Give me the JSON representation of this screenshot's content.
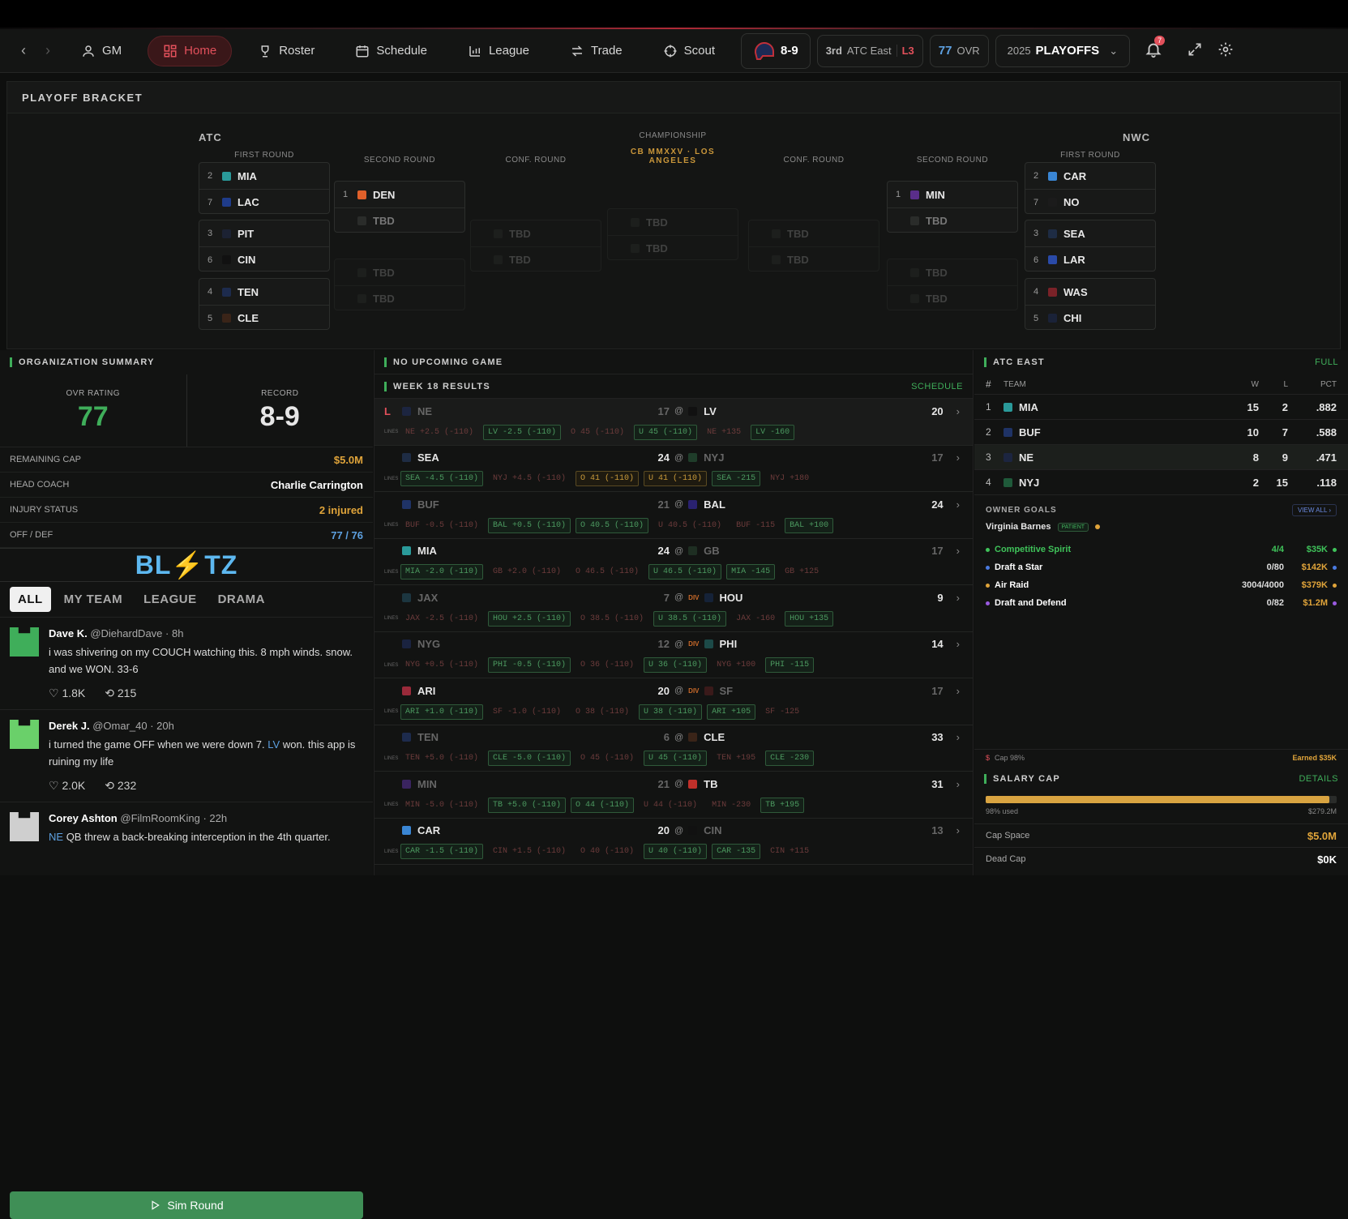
{
  "nav": {
    "user": "GM",
    "items": [
      "Home",
      "Roster",
      "Schedule",
      "League",
      "Trade",
      "Scout"
    ],
    "record": "8-9",
    "standing_rank": "3rd",
    "standing_div": "ATC East",
    "streak": "L3",
    "ovr": "77",
    "ovr_label": "OVR",
    "season": "2025",
    "phase": "PLAYOFFS",
    "notif": "7"
  },
  "bracket": {
    "title": "PLAYOFF BRACKET",
    "left_conf": "ATC",
    "right_conf": "NWC",
    "first_round": "FIRST ROUND",
    "second_round": "SECOND ROUND",
    "conf_round": "CONF. ROUND",
    "championship": "CHAMPIONSHIP",
    "champ_name": "CB MMXXV · LOS ANGELES",
    "tbd": "TBD",
    "left": [
      [
        {
          "seed": "2",
          "team": "MIA",
          "color": "#2a9a9a"
        },
        {
          "seed": "7",
          "team": "LAC",
          "color": "#1f3c8a"
        }
      ],
      [
        {
          "seed": "3",
          "team": "PIT",
          "color": "#1c2233"
        },
        {
          "seed": "6",
          "team": "CIN",
          "color": "#111"
        }
      ],
      [
        {
          "seed": "4",
          "team": "TEN",
          "color": "#1d2b4d"
        },
        {
          "seed": "5",
          "team": "CLE",
          "color": "#3a2418"
        }
      ]
    ],
    "left_second": {
      "seed": "1",
      "team": "DEN",
      "color": "#e0602a"
    },
    "right": [
      [
        {
          "seed": "2",
          "team": "CAR",
          "color": "#3a86d4"
        },
        {
          "seed": "7",
          "team": "NO",
          "color": "#1b1b1b"
        }
      ],
      [
        {
          "seed": "3",
          "team": "SEA",
          "color": "#1e2c44"
        },
        {
          "seed": "6",
          "team": "LAR",
          "color": "#2a4aa8"
        }
      ],
      [
        {
          "seed": "4",
          "team": "WAS",
          "color": "#7a2228"
        },
        {
          "seed": "5",
          "team": "CHI",
          "color": "#1a2238"
        }
      ]
    ],
    "right_second": {
      "seed": "1",
      "team": "MIN",
      "color": "#5a2e8a"
    }
  },
  "org": {
    "title": "ORGANIZATION SUMMARY",
    "ovr_label": "OVR RATING",
    "ovr": "77",
    "record_label": "RECORD",
    "record": "8-9",
    "rows": [
      {
        "k": "REMAINING CAP",
        "v": "$5.0M",
        "c": "#e0a43a"
      },
      {
        "k": "HEAD COACH",
        "v": "Charlie Carrington",
        "c": "#fff"
      },
      {
        "k": "INJURY STATUS",
        "v": "2 injured",
        "c": "#e0a43a"
      },
      {
        "k": "OFF / DEF",
        "v": "77 / 76",
        "c": "#5da0e0"
      }
    ]
  },
  "blitz": {
    "logo": "BL⚡TZ",
    "tabs": [
      "ALL",
      "MY TEAM",
      "LEAGUE",
      "DRAMA"
    ],
    "posts": [
      {
        "name": "Dave K.",
        "handle": "@DiehardDave",
        "time": "8h",
        "text": "i was shivering on my COUCH watching this. 8 mph winds. snow. and we WON. 33-6",
        "likes": "1.8K",
        "rts": "215"
      },
      {
        "name": "Derek J.",
        "handle": "@Omar_40",
        "time": "20h",
        "text_a": "i turned the game OFF when we were down 7.",
        "tag": "LV",
        "text_b": "won. this app is ruining my life",
        "likes": "2.0K",
        "rts": "232"
      },
      {
        "name": "Corey Ashton",
        "handle": "@FilmRoomKing",
        "time": "22h",
        "tag": "NE",
        "text_b": "QB threw a back-breaking interception in the 4th quarter."
      }
    ],
    "sim": "Sim Round"
  },
  "games": {
    "title": "NO UPCOMING GAME",
    "subtitle": "WEEK 18 RESULTS",
    "schedule": "SCHEDULE",
    "lines_label": "LINES",
    "list": [
      {
        "res": "L",
        "a": "NE",
        "ac": "#1c2540",
        "as": "17",
        "h": "LV",
        "hc": "#111",
        "hs": "20",
        "div": false,
        "aw": false,
        "lines": [
          [
            "NE +2.5 (-110)",
            "r"
          ],
          [
            "LV -2.5 (-110)",
            "g"
          ],
          [
            "O 45 (-110)",
            "r"
          ],
          [
            "U 45 (-110)",
            "g"
          ],
          [
            "NE +135",
            "r"
          ],
          [
            "LV -160",
            "g"
          ]
        ]
      },
      {
        "res": "",
        "a": "SEA",
        "ac": "#1e2c44",
        "as": "24",
        "h": "NYJ",
        "hc": "#1f3d2a",
        "hs": "17",
        "div": false,
        "aw": true,
        "lines": [
          [
            "SEA -4.5 (-110)",
            "g"
          ],
          [
            "NYJ +4.5 (-110)",
            "r"
          ],
          [
            "O 41 (-110)",
            "o"
          ],
          [
            "U 41 (-110)",
            "o"
          ],
          [
            "SEA -215",
            "g"
          ],
          [
            "NYJ +180",
            "r"
          ]
        ]
      },
      {
        "res": "",
        "a": "BUF",
        "ac": "#1f3366",
        "as": "21",
        "h": "BAL",
        "hc": "#2a2270",
        "hs": "24",
        "div": false,
        "aw": false,
        "lines": [
          [
            "BUF -0.5 (-110)",
            "r"
          ],
          [
            "BAL +0.5 (-110)",
            "g"
          ],
          [
            "O 40.5 (-110)",
            "g"
          ],
          [
            "U 40.5 (-110)",
            "r"
          ],
          [
            "BUF -115",
            "r"
          ],
          [
            "BAL +100",
            "g"
          ]
        ]
      },
      {
        "res": "",
        "a": "MIA",
        "ac": "#2a9a9a",
        "as": "24",
        "h": "GB",
        "hc": "#1e2e22",
        "hs": "17",
        "div": false,
        "aw": true,
        "lines": [
          [
            "MIA -2.0 (-110)",
            "g"
          ],
          [
            "GB +2.0 (-110)",
            "r"
          ],
          [
            "O 46.5 (-110)",
            "r"
          ],
          [
            "U 46.5 (-110)",
            "g"
          ],
          [
            "MIA -145",
            "g"
          ],
          [
            "GB +125",
            "r"
          ]
        ]
      },
      {
        "res": "",
        "a": "JAX",
        "ac": "#1c3640",
        "as": "7",
        "h": "HOU",
        "hc": "#152238",
        "hs": "9",
        "div": true,
        "aw": false,
        "lines": [
          [
            "JAX -2.5 (-110)",
            "r"
          ],
          [
            "HOU +2.5 (-110)",
            "g"
          ],
          [
            "O 38.5 (-110)",
            "r"
          ],
          [
            "U 38.5 (-110)",
            "g"
          ],
          [
            "JAX -160",
            "r"
          ],
          [
            "HOU +135",
            "g"
          ]
        ]
      },
      {
        "res": "",
        "a": "NYG",
        "ac": "#1a2340",
        "as": "12",
        "h": "PHI",
        "hc": "#1c4a48",
        "hs": "14",
        "div": true,
        "aw": false,
        "lines": [
          [
            "NYG +0.5 (-110)",
            "r"
          ],
          [
            "PHI -0.5 (-110)",
            "g"
          ],
          [
            "O 36 (-110)",
            "r"
          ],
          [
            "U 36 (-110)",
            "g"
          ],
          [
            "NYG +100",
            "r"
          ],
          [
            "PHI -115",
            "g"
          ]
        ]
      },
      {
        "res": "",
        "a": "ARI",
        "ac": "#9a2a3a",
        "as": "20",
        "h": "SF",
        "hc": "#3a1a1a",
        "hs": "17",
        "div": true,
        "aw": true,
        "lines": [
          [
            "ARI +1.0 (-110)",
            "g"
          ],
          [
            "SF -1.0 (-110)",
            "r"
          ],
          [
            "O 38 (-110)",
            "r"
          ],
          [
            "U 38 (-110)",
            "g"
          ],
          [
            "ARI +105",
            "g"
          ],
          [
            "SF -125",
            "r"
          ]
        ]
      },
      {
        "res": "",
        "a": "TEN",
        "ac": "#1d2b4d",
        "as": "6",
        "h": "CLE",
        "hc": "#3a2418",
        "hs": "33",
        "div": false,
        "aw": false,
        "lines": [
          [
            "TEN +5.0 (-110)",
            "r"
          ],
          [
            "CLE -5.0 (-110)",
            "g"
          ],
          [
            "O 45 (-110)",
            "r"
          ],
          [
            "U 45 (-110)",
            "g"
          ],
          [
            "TEN +195",
            "r"
          ],
          [
            "CLE -230",
            "g"
          ]
        ]
      },
      {
        "res": "",
        "a": "MIN",
        "ac": "#3a2460",
        "as": "21",
        "h": "TB",
        "hc": "#c0302a",
        "hs": "31",
        "div": false,
        "aw": false,
        "lines": [
          [
            "MIN -5.0 (-110)",
            "r"
          ],
          [
            "TB +5.0 (-110)",
            "g"
          ],
          [
            "O 44 (-110)",
            "g"
          ],
          [
            "U 44 (-110)",
            "r"
          ],
          [
            "MIN -230",
            "r"
          ],
          [
            "TB +195",
            "g"
          ]
        ]
      },
      {
        "res": "",
        "a": "CAR",
        "ac": "#3a86d4",
        "as": "20",
        "h": "CIN",
        "hc": "#111",
        "hs": "13",
        "div": false,
        "aw": true,
        "lines": [
          [
            "CAR -1.5 (-110)",
            "g"
          ],
          [
            "CIN +1.5 (-110)",
            "r"
          ],
          [
            "O 40 (-110)",
            "r"
          ],
          [
            "U 40 (-110)",
            "g"
          ],
          [
            "CAR -135",
            "g"
          ],
          [
            "CIN +115",
            "r"
          ]
        ]
      }
    ]
  },
  "standings": {
    "title": "ATC EAST",
    "full": "FULL",
    "cols": [
      "#",
      "TEAM",
      "W",
      "L",
      "PCT"
    ],
    "rows": [
      {
        "r": "1",
        "t": "MIA",
        "c": "#2a9a9a",
        "w": "15",
        "l": "2",
        "p": ".882"
      },
      {
        "r": "2",
        "t": "BUF",
        "c": "#1f3366",
        "w": "10",
        "l": "7",
        "p": ".588"
      },
      {
        "r": "3",
        "t": "NE",
        "c": "#1c2540",
        "w": "8",
        "l": "9",
        "p": ".471"
      },
      {
        "r": "4",
        "t": "NYJ",
        "c": "#1f5a3a",
        "w": "2",
        "l": "15",
        "p": ".118"
      }
    ]
  },
  "goals": {
    "title": "OWNER GOALS",
    "view_all": "VIEW ALL ›",
    "owner": "Virginia Barnes",
    "badge": "PATIENT",
    "list": [
      {
        "n": "Competitive Spirit",
        "p": "4/4",
        "r": "$35K",
        "c": "#3fc35a",
        "done": true
      },
      {
        "n": "Draft a Star",
        "p": "0/80",
        "r": "$142K",
        "c": "#4a7ae0"
      },
      {
        "n": "Air Raid",
        "p": "3004/4000",
        "r": "$379K",
        "c": "#e0a43a"
      },
      {
        "n": "Draft and Defend",
        "p": "0/82",
        "r": "$1.2M",
        "c": "#9a5ae0"
      }
    ],
    "cap_label": "Cap 98%",
    "earned": "Earned $35K"
  },
  "cap": {
    "title": "SALARY CAP",
    "details": "DETAILS",
    "used": "98% used",
    "total": "$279.2M",
    "used_pct": 98,
    "rows": [
      {
        "k": "Cap Space",
        "v": "$5.0M",
        "c": "#e0a43a"
      },
      {
        "k": "Dead Cap",
        "v": "$0K",
        "c": "#fff"
      }
    ]
  }
}
